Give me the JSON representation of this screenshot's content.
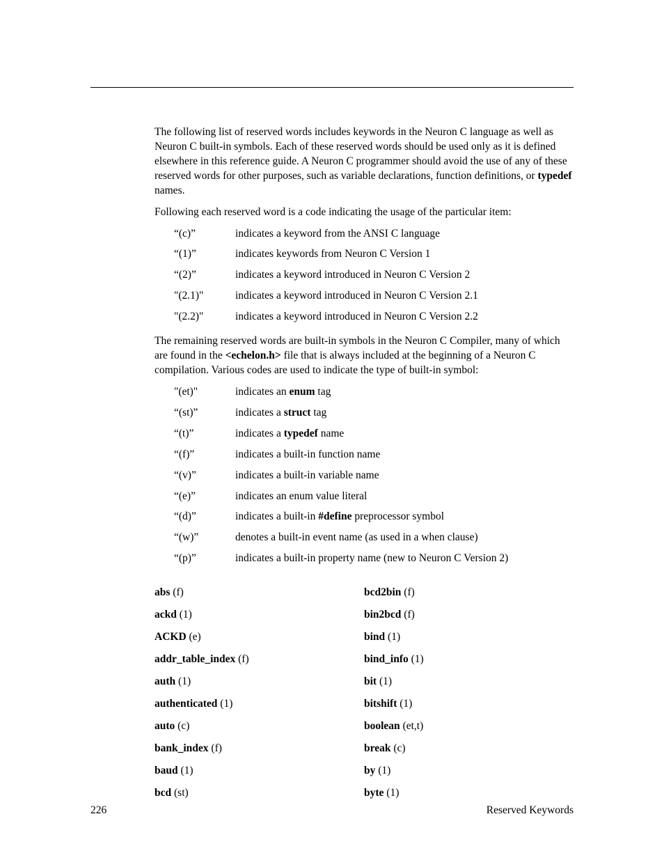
{
  "para1": {
    "t1": "The following list of reserved words includes keywords in the Neuron C language as well as Neuron C built-in symbols.  Each of these reserved words should be used only as it is defined elsewhere in this reference guide.  A Neuron C programmer should avoid the use of any of these reserved words for other purposes, such as variable declarations, function definitions, or ",
    "b1": "typedef",
    "t2": " names."
  },
  "para2": "Following each reserved word is a code indicating the usage of the particular item:",
  "codes1": [
    {
      "k": "“(c)”",
      "d": "indicates a keyword from the ANSI C language"
    },
    {
      "k": "“(1)”",
      "d": "indicates keywords from Neuron C Version 1"
    },
    {
      "k": "“(2)”",
      "d": "indicates a keyword introduced in Neuron C Version 2"
    },
    {
      "k": "\"(2.1)\"",
      "d": "indicates a keyword introduced in Neuron C Version 2.1"
    },
    {
      "k": "\"(2.2)\"",
      "d": "indicates a keyword introduced in Neuron C Version 2.2"
    }
  ],
  "para3": {
    "t1": "The remaining reserved words are built-in symbols in the Neuron C Compiler, many of which are found in the ",
    "b1": "<echelon.h>",
    "t2": " file that is always included at the beginning of a Neuron C compilation.  Various codes are used to indicate the type of built-in symbol:"
  },
  "codes2": [
    {
      "k": "\"(et)\"",
      "pre": "indicates an ",
      "b": "enum",
      "post": " tag"
    },
    {
      "k": "“(st)”",
      "pre": "indicates a ",
      "b": "struct",
      "post": " tag"
    },
    {
      "k": "“(t)”",
      "pre": "indicates a ",
      "b": "typedef",
      "post": " name"
    },
    {
      "k": "“(f)”",
      "pre": "indicates a built-in function name",
      "b": "",
      "post": ""
    },
    {
      "k": "“(v)”",
      "pre": "indicates a built-in variable name",
      "b": "",
      "post": ""
    },
    {
      "k": "“(e)”",
      "pre": "indicates an enum value literal",
      "b": "",
      "post": ""
    },
    {
      "k": "“(d)”",
      "pre": "indicates a built-in ",
      "b": "#define",
      "post": " preprocessor symbol"
    },
    {
      "k": "“(w)”",
      "pre": "denotes a built-in event name (as used in a when clause)",
      "b": "",
      "post": ""
    },
    {
      "k": "“(p)”",
      "pre": "indicates a built-in property name (new to Neuron C Version 2)",
      "b": "",
      "post": ""
    }
  ],
  "wordsL": [
    {
      "w": "abs",
      "c": " (f)"
    },
    {
      "w": "ackd",
      "c": " (1)"
    },
    {
      "w": "ACKD",
      "c": " (e)"
    },
    {
      "w": "addr_table_index",
      "c": " (f)"
    },
    {
      "w": "auth",
      "c": " (1)"
    },
    {
      "w": "authenticated",
      "c": " (1)"
    },
    {
      "w": "auto",
      "c": " (c)"
    },
    {
      "w": "bank_index",
      "c": " (f)"
    },
    {
      "w": "baud",
      "c": " (1)"
    },
    {
      "w": "bcd",
      "c": " (st)"
    }
  ],
  "wordsR": [
    {
      "w": "bcd2bin",
      "c": " (f)"
    },
    {
      "w": "bin2bcd",
      "c": " (f)"
    },
    {
      "w": "bind",
      "c": " (1)"
    },
    {
      "w": "bind_info",
      "c": " (1)"
    },
    {
      "w": "bit",
      "c": " (1)"
    },
    {
      "w": "bitshift",
      "c": " (1)"
    },
    {
      "w": "boolean",
      "c": " (et,t)"
    },
    {
      "w": "break",
      "c": " (c)"
    },
    {
      "w": "by",
      "c": " (1)"
    },
    {
      "w": "byte",
      "c": " (1)"
    }
  ],
  "footer": {
    "page": "226",
    "title": "Reserved Keywords"
  }
}
